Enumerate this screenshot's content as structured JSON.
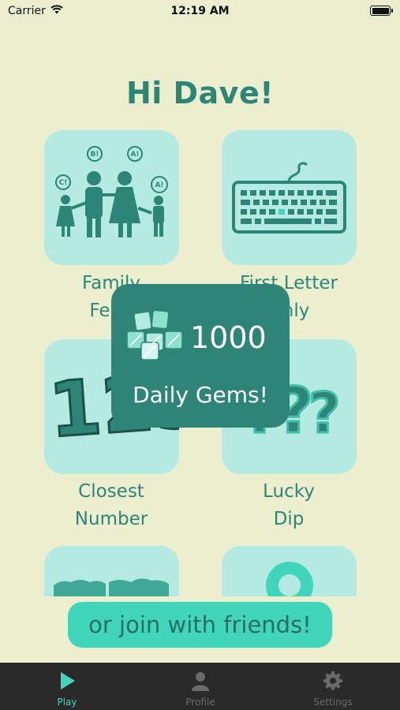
{
  "status": {
    "carrier": "Carrier",
    "time": "12:19 AM"
  },
  "greeting": "Hi Dave!",
  "games": [
    {
      "line1": "Family",
      "line2": "Feud",
      "icon": "family-icon"
    },
    {
      "line1": "First Letter",
      "line2": "Only",
      "icon": "keyboard-icon"
    },
    {
      "line1": "Closest",
      "line2": "Number",
      "icon": "numbers-icon"
    },
    {
      "line1": "Lucky",
      "line2": "Dip",
      "icon": "question-marks-icon"
    },
    {
      "icon": "world-map-icon"
    },
    {
      "icon": "map-pin-icon"
    }
  ],
  "family_bubbles": [
    "C!",
    "B!",
    "A!",
    "A!"
  ],
  "number_art": "123",
  "popup": {
    "count": "1000",
    "text": "Daily Gems!",
    "icon": "gems-icon"
  },
  "join_button": "or join with friends!",
  "tabs": [
    {
      "label": "Play",
      "icon": "play-icon",
      "active": true
    },
    {
      "label": "Profile",
      "icon": "person-icon",
      "active": false
    },
    {
      "label": "Settings",
      "icon": "gear-icon",
      "active": false
    }
  ],
  "colors": {
    "background": "#ECEFCF",
    "card": "#B5EAE2",
    "accent": "#2D8577",
    "button": "#41D6BC",
    "tab_active": "#41D6BC",
    "tab_inactive": "#6A6A6A"
  }
}
